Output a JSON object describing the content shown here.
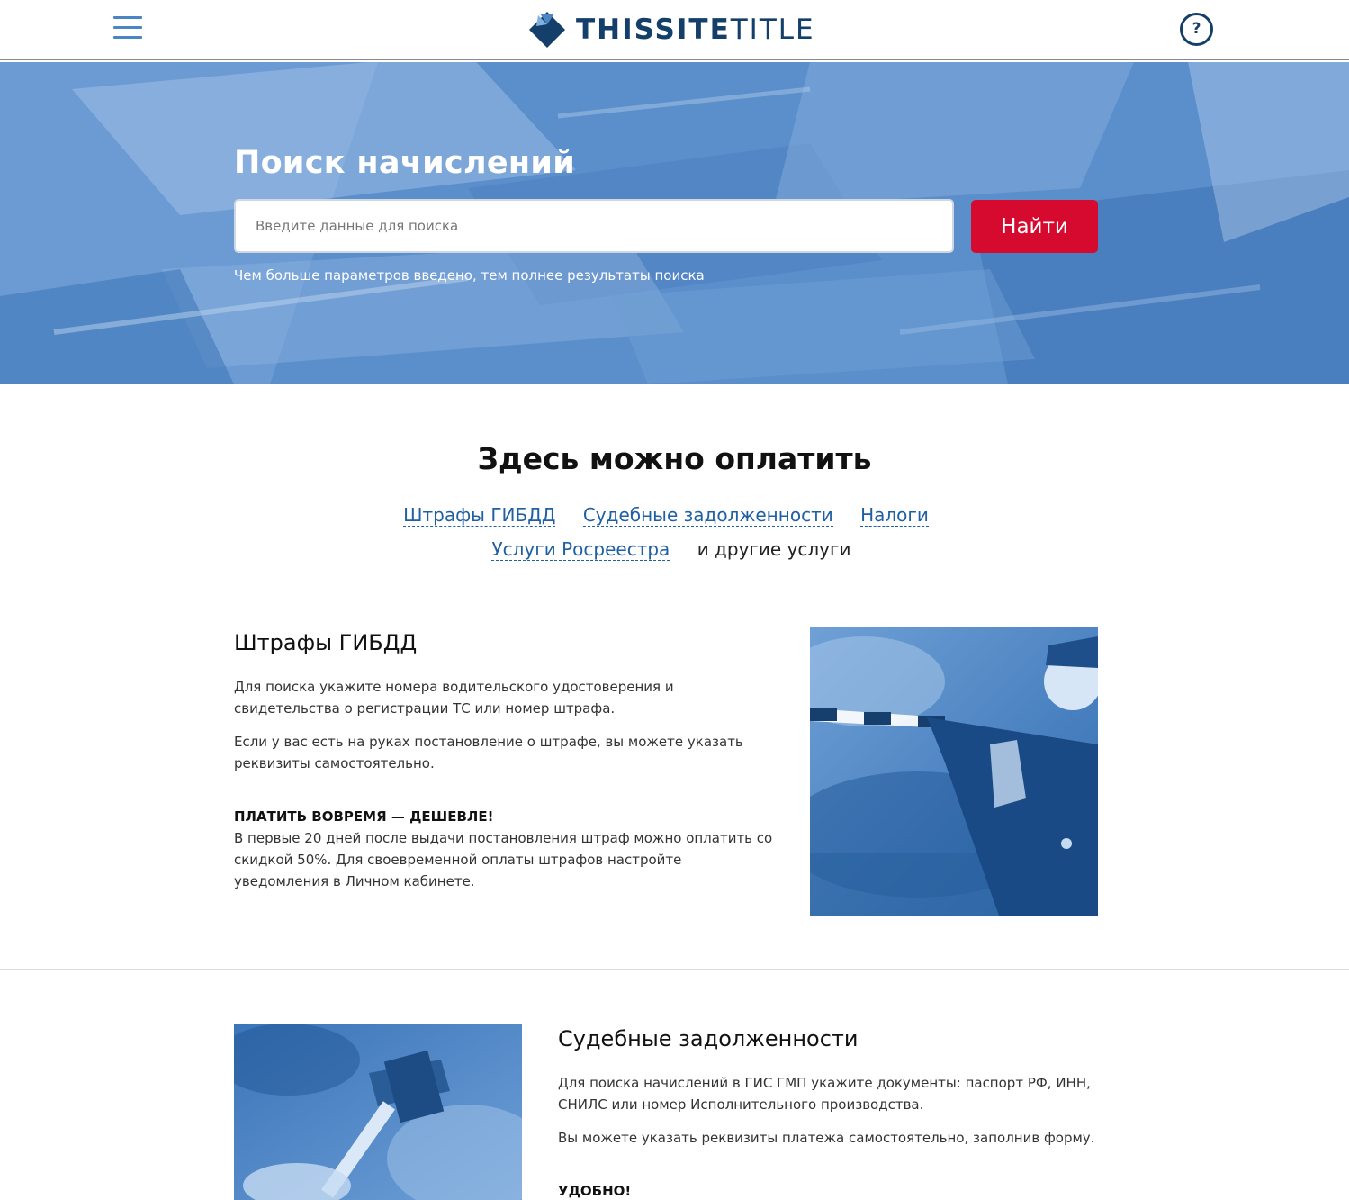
{
  "header": {
    "logo_bold": "THISSITE",
    "logo_thin": "TITLE",
    "help_label": "?"
  },
  "hero": {
    "title": "Поиск начислений",
    "search_placeholder": "Введите данные для поиска",
    "search_button": "Найти",
    "hint": "Чем больше параметров введено, тем полнее результаты поиска"
  },
  "pay": {
    "title": "Здесь можно оплатить",
    "links": [
      "Штрафы ГИБДД",
      "Судебные задолженности",
      "Налоги",
      "Услуги Росреестра"
    ],
    "other": "и другие услуги"
  },
  "gibdd": {
    "title": "Штрафы ГИБДД",
    "p1": "Для поиска укажите номера водительского удостоверения и свидетельства о регистрации ТС или номер штрафа.",
    "p2": "Если у вас есть на руках постановление о штрафе, вы можете указать реквизиты самостоятельно.",
    "strong": "ПЛАТИТЬ ВОВРЕМЯ — ДЕШЕВЛЕ!",
    "p3": "В первые 20 дней после выдачи постановления штраф можно оплатить со скидкой 50%. Для своевременной оплаты штрафов настройте уведомления в Личном кабинете."
  },
  "court": {
    "title": "Судебные задолженности",
    "p1": "Для поиска начислений в ГИС ГМП укажите документы: паспорт РФ, ИНН, СНИЛС или номер Исполнительного производства.",
    "p2": "Вы можете указать реквизиты платежа самостоятельно, заполнив форму.",
    "strong": "УДОБНО!"
  },
  "colors": {
    "brand": "#143f6a",
    "accent": "#d50a2e",
    "link": "#1f5fa3",
    "hero": "#4a82c3"
  }
}
